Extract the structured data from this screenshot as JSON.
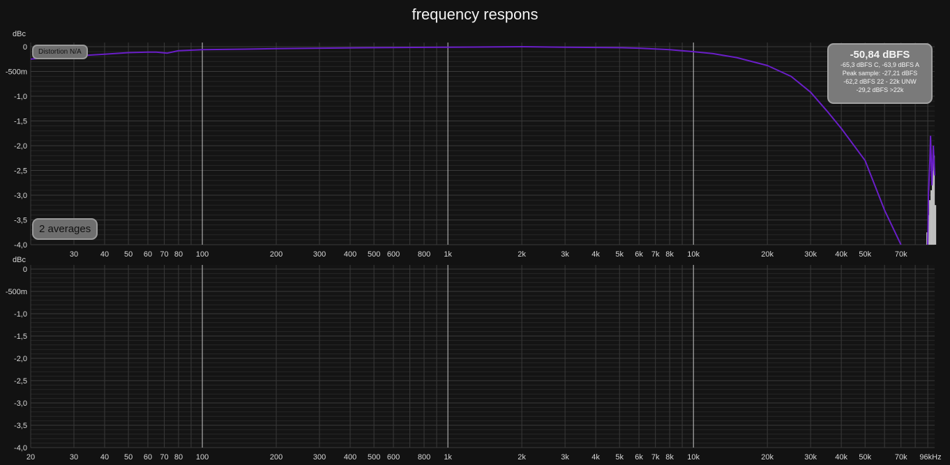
{
  "window": {
    "title": "frequency respons"
  },
  "badges": {
    "distortion": "Distortion N/A",
    "averages": "2 averages"
  },
  "level_panel": {
    "main": "-50,84 dBFS",
    "lines": [
      "-65,3 dBFS C, -63,9 dBFS A",
      "Peak sample: -27,21 dBFS",
      "-62,2 dBFS 22 - 22k UNW",
      "-29,2 dBFS >22k"
    ]
  },
  "colors": {
    "background": "#121212",
    "plot_bg": "#141414",
    "grid": "#3a3a3a",
    "grid_major": "#c8c8c8",
    "series": "#6a1ec8",
    "bars": "#c8c8c8"
  },
  "chart_data": [
    {
      "type": "line",
      "title": "frequency respons",
      "ylabel": "dBc",
      "xscale": "log",
      "xlim": [
        20,
        96000
      ],
      "ylim": [
        -4.0,
        0.0
      ],
      "grid": true,
      "ytick_labels": [
        "0",
        "-500m",
        "-1,0",
        "-1,5",
        "-2,0",
        "-2,5",
        "-3,0",
        "-3,5",
        "-4,0"
      ],
      "ytick_values": [
        0,
        -0.5,
        -1.0,
        -1.5,
        -2.0,
        -2.5,
        -3.0,
        -3.5,
        -4.0
      ],
      "xtick_labels": [
        "30",
        "40",
        "50",
        "60",
        "70",
        "80",
        "100",
        "200",
        "300",
        "400",
        "500",
        "600",
        "800",
        "1k",
        "2k",
        "3k",
        "4k",
        "5k",
        "6k",
        "7k",
        "8k",
        "10k",
        "20k",
        "30k",
        "40k",
        "50k",
        "70k"
      ],
      "xtick_values": [
        30,
        40,
        50,
        60,
        70,
        80,
        100,
        200,
        300,
        400,
        500,
        600,
        800,
        1000,
        2000,
        3000,
        4000,
        5000,
        6000,
        7000,
        8000,
        10000,
        20000,
        30000,
        40000,
        50000,
        70000
      ],
      "series": [
        {
          "x": [
            20,
            25,
            30,
            40,
            50,
            60,
            65,
            72,
            80,
            100,
            150,
            200,
            300,
            500,
            1000,
            2000,
            3000,
            5000,
            6000,
            8000,
            10000,
            12000,
            15000,
            20000,
            25000,
            30000,
            35000,
            40000,
            50000,
            60000,
            70000
          ],
          "y": [
            -0.25,
            -0.21,
            -0.19,
            -0.15,
            -0.12,
            -0.11,
            -0.11,
            -0.13,
            -0.08,
            -0.06,
            -0.05,
            -0.04,
            -0.03,
            -0.02,
            -0.01,
            0.0,
            -0.01,
            -0.02,
            -0.03,
            -0.06,
            -0.1,
            -0.14,
            -0.22,
            -0.38,
            -0.6,
            -0.92,
            -1.3,
            -1.65,
            -2.3,
            -3.3,
            -4.0
          ]
        }
      ],
      "spike_x": 93000,
      "spike_y": -1.8
    },
    {
      "type": "line",
      "ylabel": "dBc",
      "xscale": "log",
      "xlim": [
        20,
        96000
      ],
      "ylim": [
        -4.0,
        0.0
      ],
      "grid": true,
      "ytick_labels": [
        "0",
        "-500m",
        "-1,0",
        "-1,5",
        "-2,0",
        "-2,5",
        "-3,0",
        "-3,5",
        "-4,0"
      ],
      "ytick_values": [
        0,
        -0.5,
        -1.0,
        -1.5,
        -2.0,
        -2.5,
        -3.0,
        -3.5,
        -4.0
      ],
      "xtick_labels": [
        "20",
        "30",
        "40",
        "50",
        "60",
        "70",
        "80",
        "100",
        "200",
        "300",
        "400",
        "500",
        "600",
        "800",
        "1k",
        "2k",
        "3k",
        "4k",
        "5k",
        "6k",
        "7k",
        "8k",
        "10k",
        "20k",
        "30k",
        "40k",
        "50k",
        "70k",
        "96kHz"
      ],
      "xtick_values": [
        20,
        30,
        40,
        50,
        60,
        70,
        80,
        100,
        200,
        300,
        400,
        500,
        600,
        800,
        1000,
        2000,
        3000,
        4000,
        5000,
        6000,
        7000,
        8000,
        10000,
        20000,
        30000,
        40000,
        50000,
        70000,
        96000
      ],
      "series": []
    }
  ]
}
